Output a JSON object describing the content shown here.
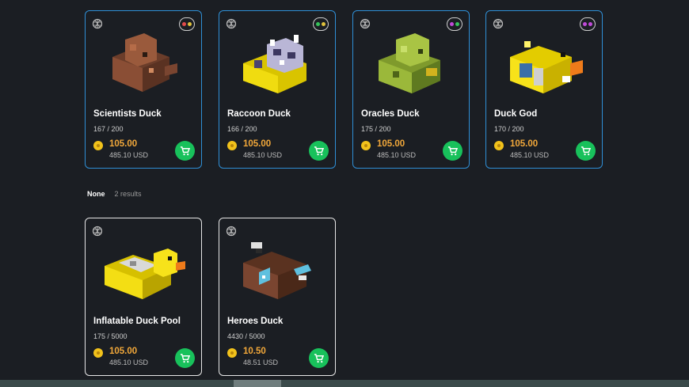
{
  "cards": [
    {
      "name": "Scientists Duck",
      "supply": "167 / 200",
      "price": "105.00",
      "usd": "485.10 USD",
      "dots": [
        "#e24b4b",
        "#e0c23c"
      ]
    },
    {
      "name": "Raccoon Duck",
      "supply": "166 / 200",
      "price": "105.00",
      "usd": "485.10 USD",
      "dots": [
        "#36c25a",
        "#e0c23c"
      ]
    },
    {
      "name": "Oracles Duck",
      "supply": "175 / 200",
      "price": "105.00",
      "usd": "485.10 USD",
      "dots": [
        "#c04ad8",
        "#36c25a"
      ]
    },
    {
      "name": "Duck God",
      "supply": "170 / 200",
      "price": "105.00",
      "usd": "485.10 USD",
      "dots": [
        "#c04ad8",
        "#c04ad8"
      ]
    },
    {
      "name": "Inflatable Duck Pool",
      "supply": "175 / 5000",
      "price": "105.00",
      "usd": "485.10 USD"
    },
    {
      "name": "Heroes Duck",
      "supply": "4430 / 5000",
      "price": "10.50",
      "usd": "48.51 USD"
    }
  ],
  "filter": {
    "label": "None",
    "count": "2 results"
  },
  "colors": {
    "accent_border": "#2f8fd6",
    "price": "#f2a83a",
    "cart": "#18c15b",
    "coin": "#f2c21b"
  }
}
